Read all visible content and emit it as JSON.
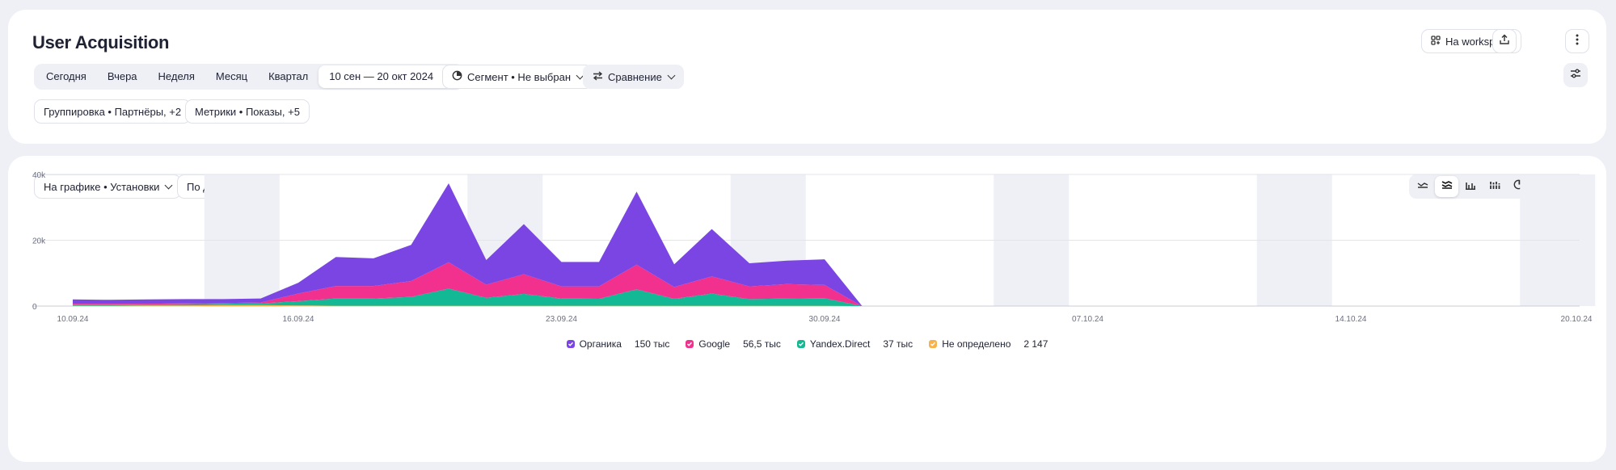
{
  "header": {
    "title": "User Acquisition",
    "workspace_label": "На workspace"
  },
  "period": {
    "items": [
      "Сегодня",
      "Вчера",
      "Неделя",
      "Месяц",
      "Квартал"
    ],
    "range": "10 сен — 20 окт 2024"
  },
  "filters": {
    "segment": "Сегмент • Не выбран",
    "compare": "Сравнение",
    "grouping": "Группировка • Партнёры, +2",
    "metrics": "Метрики • Показы, +5"
  },
  "chart_controls": {
    "metric_select": "На графике • Установки",
    "granularity": "По дням"
  },
  "icons": {
    "workspace": "workspace-grid-icon",
    "export": "export-upload-icon",
    "more": "more-vertical-icon",
    "settings": "filter-settings-icon",
    "chart_settings": "gear-icon",
    "chart_types": [
      "line-chart-icon",
      "stacked-area-icon",
      "bar-chart-icon",
      "stacked-bar-icon",
      "pie-chart-icon",
      "column-chart-icon"
    ]
  },
  "colors": {
    "organic": "#7b45e4",
    "google": "#f2318f",
    "yandex_direct": "#13b894",
    "undefined": "#f7b24a",
    "weekend": "#eef0f5"
  },
  "chart_data": {
    "type": "area",
    "stacked": true,
    "ylim": [
      0,
      40000
    ],
    "y_ticks": [
      "0",
      "20k",
      "40k"
    ],
    "x_tick_labels": [
      "10.09.24",
      "16.09.24",
      "23.09.24",
      "30.09.24",
      "07.10.24",
      "14.10.24",
      "20.10.24"
    ],
    "x": [
      "10.09.24",
      "11.09.24",
      "12.09.24",
      "13.09.24",
      "14.09.24",
      "15.09.24",
      "16.09.24",
      "17.09.24",
      "18.09.24",
      "19.09.24",
      "20.09.24",
      "21.09.24",
      "22.09.24",
      "23.09.24",
      "24.09.24",
      "25.09.24",
      "26.09.24",
      "27.09.24",
      "28.09.24",
      "29.09.24",
      "30.09.24",
      "01.10.24"
    ],
    "series": [
      {
        "name": "Не определено",
        "total": "2 147",
        "values": [
          100,
          100,
          200,
          200,
          300,
          300,
          200,
          100,
          100,
          100,
          100,
          100,
          100,
          100,
          100,
          100,
          100,
          100,
          100,
          100,
          100,
          0
        ]
      },
      {
        "name": "Yandex.Direct",
        "total": "37 тыс",
        "values": [
          300,
          300,
          300,
          400,
          400,
          500,
          1300,
          2200,
          2200,
          2700,
          5200,
          2400,
          3600,
          2200,
          2100,
          5000,
          2100,
          3700,
          2000,
          2200,
          2300,
          0
        ]
      },
      {
        "name": "Google",
        "total": "56,5 тыс",
        "values": [
          300,
          300,
          200,
          200,
          200,
          300,
          2300,
          3800,
          3800,
          4800,
          8000,
          4000,
          6000,
          3700,
          3800,
          7500,
          3600,
          5200,
          3900,
          4400,
          4000,
          0
        ]
      },
      {
        "name": "Органика",
        "total": "150 тыс",
        "values": [
          1300,
          1200,
          1300,
          1300,
          1200,
          1200,
          3300,
          8800,
          8400,
          11000,
          24000,
          7500,
          15200,
          7400,
          7400,
          22200,
          6900,
          14400,
          7000,
          7100,
          7800,
          0
        ]
      }
    ],
    "legend_order": [
      "Органика",
      "Google",
      "Yandex.Direct",
      "Не определено"
    ]
  }
}
